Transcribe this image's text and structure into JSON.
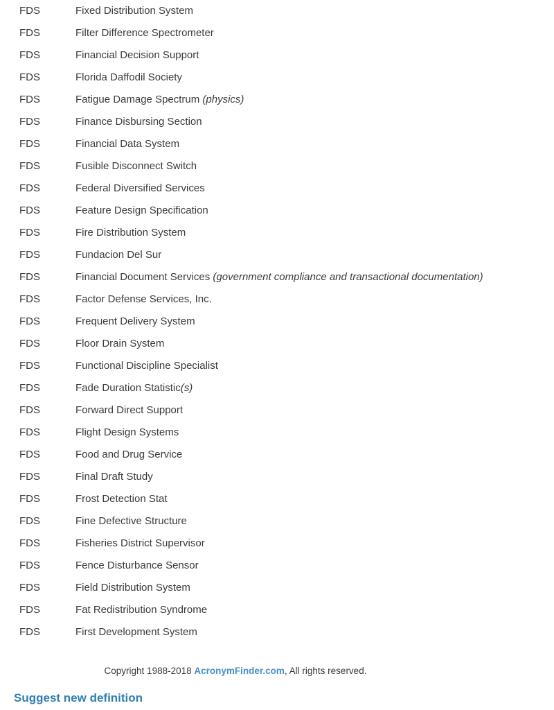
{
  "definitions": [
    {
      "abbr": "FDS",
      "meaning": "Fixed Distribution System",
      "note": ""
    },
    {
      "abbr": "FDS",
      "meaning": "Filter Difference Spectrometer",
      "note": ""
    },
    {
      "abbr": "FDS",
      "meaning": "Financial Decision Support",
      "note": ""
    },
    {
      "abbr": "FDS",
      "meaning": "Florida Daffodil Society",
      "note": ""
    },
    {
      "abbr": "FDS",
      "meaning": "Fatigue Damage Spectrum ",
      "note": "(physics)"
    },
    {
      "abbr": "FDS",
      "meaning": "Finance Disbursing Section",
      "note": ""
    },
    {
      "abbr": "FDS",
      "meaning": "Financial Data System",
      "note": ""
    },
    {
      "abbr": "FDS",
      "meaning": "Fusible Disconnect Switch",
      "note": ""
    },
    {
      "abbr": "FDS",
      "meaning": "Federal Diversified Services",
      "note": ""
    },
    {
      "abbr": "FDS",
      "meaning": "Feature Design Specification",
      "note": ""
    },
    {
      "abbr": "FDS",
      "meaning": "Fire Distribution System",
      "note": ""
    },
    {
      "abbr": "FDS",
      "meaning": "Fundacion Del Sur",
      "note": ""
    },
    {
      "abbr": "FDS",
      "meaning": "Financial Document Services ",
      "note": "(government compliance and transactional documentation)"
    },
    {
      "abbr": "FDS",
      "meaning": "Factor Defense Services, Inc.",
      "note": ""
    },
    {
      "abbr": "FDS",
      "meaning": "Frequent Delivery System",
      "note": ""
    },
    {
      "abbr": "FDS",
      "meaning": "Floor Drain System",
      "note": ""
    },
    {
      "abbr": "FDS",
      "meaning": "Functional Discipline Specialist",
      "note": ""
    },
    {
      "abbr": "FDS",
      "meaning": "Fade Duration Statistic",
      "note": "(s)"
    },
    {
      "abbr": "FDS",
      "meaning": "Forward Direct Support",
      "note": ""
    },
    {
      "abbr": "FDS",
      "meaning": "Flight Design Systems",
      "note": ""
    },
    {
      "abbr": "FDS",
      "meaning": "Food and Drug Service",
      "note": ""
    },
    {
      "abbr": "FDS",
      "meaning": "Final Draft Study",
      "note": ""
    },
    {
      "abbr": "FDS",
      "meaning": "Frost Detection Stat",
      "note": ""
    },
    {
      "abbr": "FDS",
      "meaning": "Fine Defective Structure",
      "note": ""
    },
    {
      "abbr": "FDS",
      "meaning": "Fisheries District Supervisor",
      "note": ""
    },
    {
      "abbr": "FDS",
      "meaning": "Fence Disturbance Sensor",
      "note": ""
    },
    {
      "abbr": "FDS",
      "meaning": "Field Distribution System",
      "note": ""
    },
    {
      "abbr": "FDS",
      "meaning": "Fat Redistribution Syndrome",
      "note": ""
    },
    {
      "abbr": "FDS",
      "meaning": "First Development System",
      "note": ""
    }
  ],
  "footer": {
    "copyright_prefix": "Copyright 1988-2018 ",
    "site_link": "AcronymFinder.com",
    "copyright_suffix": ", All rights reserved.",
    "suggest_link": "Suggest new definition"
  },
  "colors": {
    "link_blue": "#4a90c4",
    "heading_blue": "#2f7fb0",
    "text_gray": "#3a3a3a",
    "background": "#ffffff"
  }
}
